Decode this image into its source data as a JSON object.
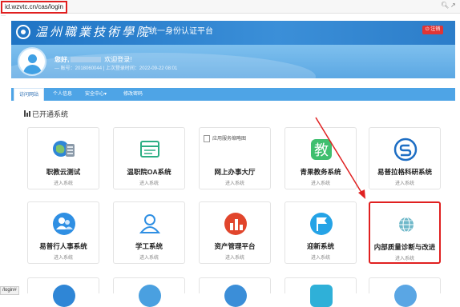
{
  "browser": {
    "url": "id.wzvtc.cn/cas/login",
    "zoom_icon": "zoom-icon",
    "share_icon": "share-icon",
    "status_text": "/login#"
  },
  "header": {
    "school_name": "温州職業技術學院",
    "platform_title": "统一身份认证平台"
  },
  "user": {
    "greeting": "您好,",
    "welcome": "欢迎登录!",
    "account_line": "— 账号：2018060044 | 上次登录时间：2022-09-22 08:01",
    "logout_label": "注销"
  },
  "tabs": [
    "访问网站",
    "个人信息",
    "安全中心▾",
    "修改密码"
  ],
  "section_title": "已开通系统",
  "enter_label": "进入系统",
  "tiles_row1": [
    {
      "name": "职教云测试",
      "icon": "cloud-server-icon"
    },
    {
      "name": "温职院OA系统",
      "icon": "oa-document-icon"
    },
    {
      "name": "网上办事大厅",
      "icon": "broken-image-icon",
      "alt": "应用服务缩略图"
    },
    {
      "name": "青果教务系统",
      "icon": "jiao-badge-icon",
      "glyph": "教"
    },
    {
      "name": "易普拉格科研系统",
      "icon": "research-s-icon"
    }
  ],
  "tiles_row2": [
    {
      "name": "易普行人事系统",
      "icon": "people-icon"
    },
    {
      "name": "学工系统",
      "icon": "user-outline-icon"
    },
    {
      "name": "资产管理平台",
      "icon": "asset-chart-icon"
    },
    {
      "name": "迎新系统",
      "icon": "flag-icon"
    },
    {
      "name": "内部质量诊断与改进",
      "icon": "globe-icon"
    }
  ],
  "colors": {
    "header": "#1f74c4",
    "banner": "#6fb6ea",
    "tab_bar": "#4ea4e6",
    "highlight": "#e02020",
    "logout": "#e03535"
  },
  "annotation": {
    "arrow": "red-arrow-pointing-to-highlighted-tile"
  }
}
